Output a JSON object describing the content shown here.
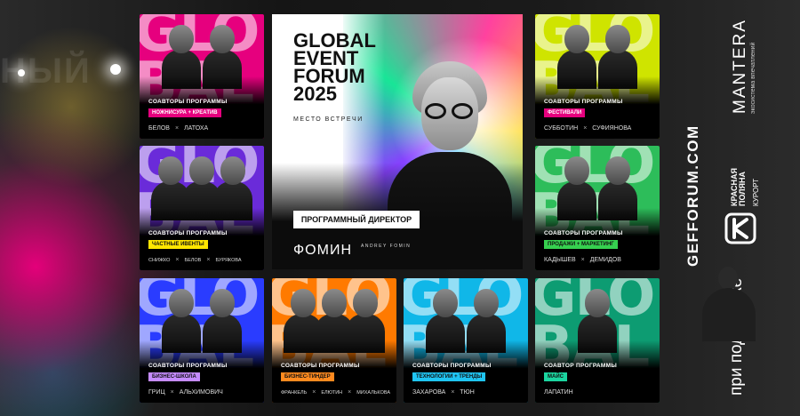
{
  "event": {
    "title": "GLOBAL EVENT FORUM 2025",
    "tagline": "МЕСТО ВСТРЕЧИ",
    "role": "ПРОГРАММНЫЙ ДИРЕКТОР",
    "director": "ФОМИН",
    "signature": "ANDREY FOMIN"
  },
  "sidebar": {
    "website": "GEFFORUM.COM",
    "support": "при поддержке",
    "mantera_name": "MANTERA",
    "mantera_sub": "экосистема впечатлений",
    "kp_name": "КРАСНАЯ ПОЛЯНА",
    "kp_sub": "КУРОРТ"
  },
  "background": {
    "word": "НЫЙ"
  },
  "cards": [
    {
      "id": "c1",
      "header": "СОАВТОРЫ ПРОГРАММЫ",
      "tag": "НОЖНИСУРА + КРЕАТИВ",
      "names": [
        "БЕЛОВ",
        "ЛАТОХА"
      ],
      "bg": "#e6007e",
      "tag_color": "#e6007e",
      "tag_text": "#fff"
    },
    {
      "id": "c2",
      "header": "СОАВТОРЫ ПРОГРАММЫ",
      "tag": "ФЕСТИВАЛИ",
      "names": [
        "СУББОТИН",
        "СУФИЯНОВА"
      ],
      "bg": "#cfe400",
      "tag_color": "#e6007e",
      "tag_text": "#fff"
    },
    {
      "id": "c3",
      "header": "СОАВТОРЫ ПРОГРАММЫ",
      "tag": "ЧАСТНЫЕ ИВЕНТЫ",
      "names": [
        "СНИЖКО",
        "БЕЛОВ",
        "БУРЯКОВА"
      ],
      "bg": "#6a2bd9",
      "tag_color": "#ffe600",
      "tag_text": "#111"
    },
    {
      "id": "c4",
      "header": "СОАВТОРЫ ПРОГРАММЫ",
      "tag": "ПРОДАЖИ + МАРКЕТИНГ",
      "names": [
        "КАДЫШЕВ",
        "ДЕМИДОВ"
      ],
      "bg": "#2dbd5a",
      "tag_color": "#36d04f",
      "tag_text": "#111"
    },
    {
      "id": "c5",
      "header": "СОАВТОРЫ ПРОГРАММЫ",
      "tag": "БИЗНЕС-ШКОЛА",
      "names": [
        "ГРИЦ",
        "АЛЬХИМОВИЧ"
      ],
      "bg": "#2a3cff",
      "tag_color": "#c58bff",
      "tag_text": "#111"
    },
    {
      "id": "c6",
      "header": "СОАВТОРЫ ПРОГРАММЫ",
      "tag": "БИЗНЕС-ТИНДЕР",
      "names": [
        "ФРАНКЕЛЬ",
        "ЕЛЮТИН",
        "МИХАЛЬКОВА"
      ],
      "bg": "#ff7a00",
      "tag_color": "#ff8a1f",
      "tag_text": "#111"
    },
    {
      "id": "c7",
      "header": "СОАВТОРЫ ПРОГРАММЫ",
      "tag": "ТЕХНОЛОГИИ + ТРЕНДЫ",
      "names": [
        "ЗАХАРОВА",
        "ТЮН"
      ],
      "bg": "#10b7e8",
      "tag_color": "#1fc4f2",
      "tag_text": "#111"
    },
    {
      "id": "c8",
      "header": "СОАВТОР ПРОГРАММЫ",
      "tag": "МАЙС",
      "names": [
        "ЛАПАТИН"
      ],
      "bg": "#0d9c72",
      "tag_color": "#1bd5a0",
      "tag_text": "#111"
    }
  ]
}
